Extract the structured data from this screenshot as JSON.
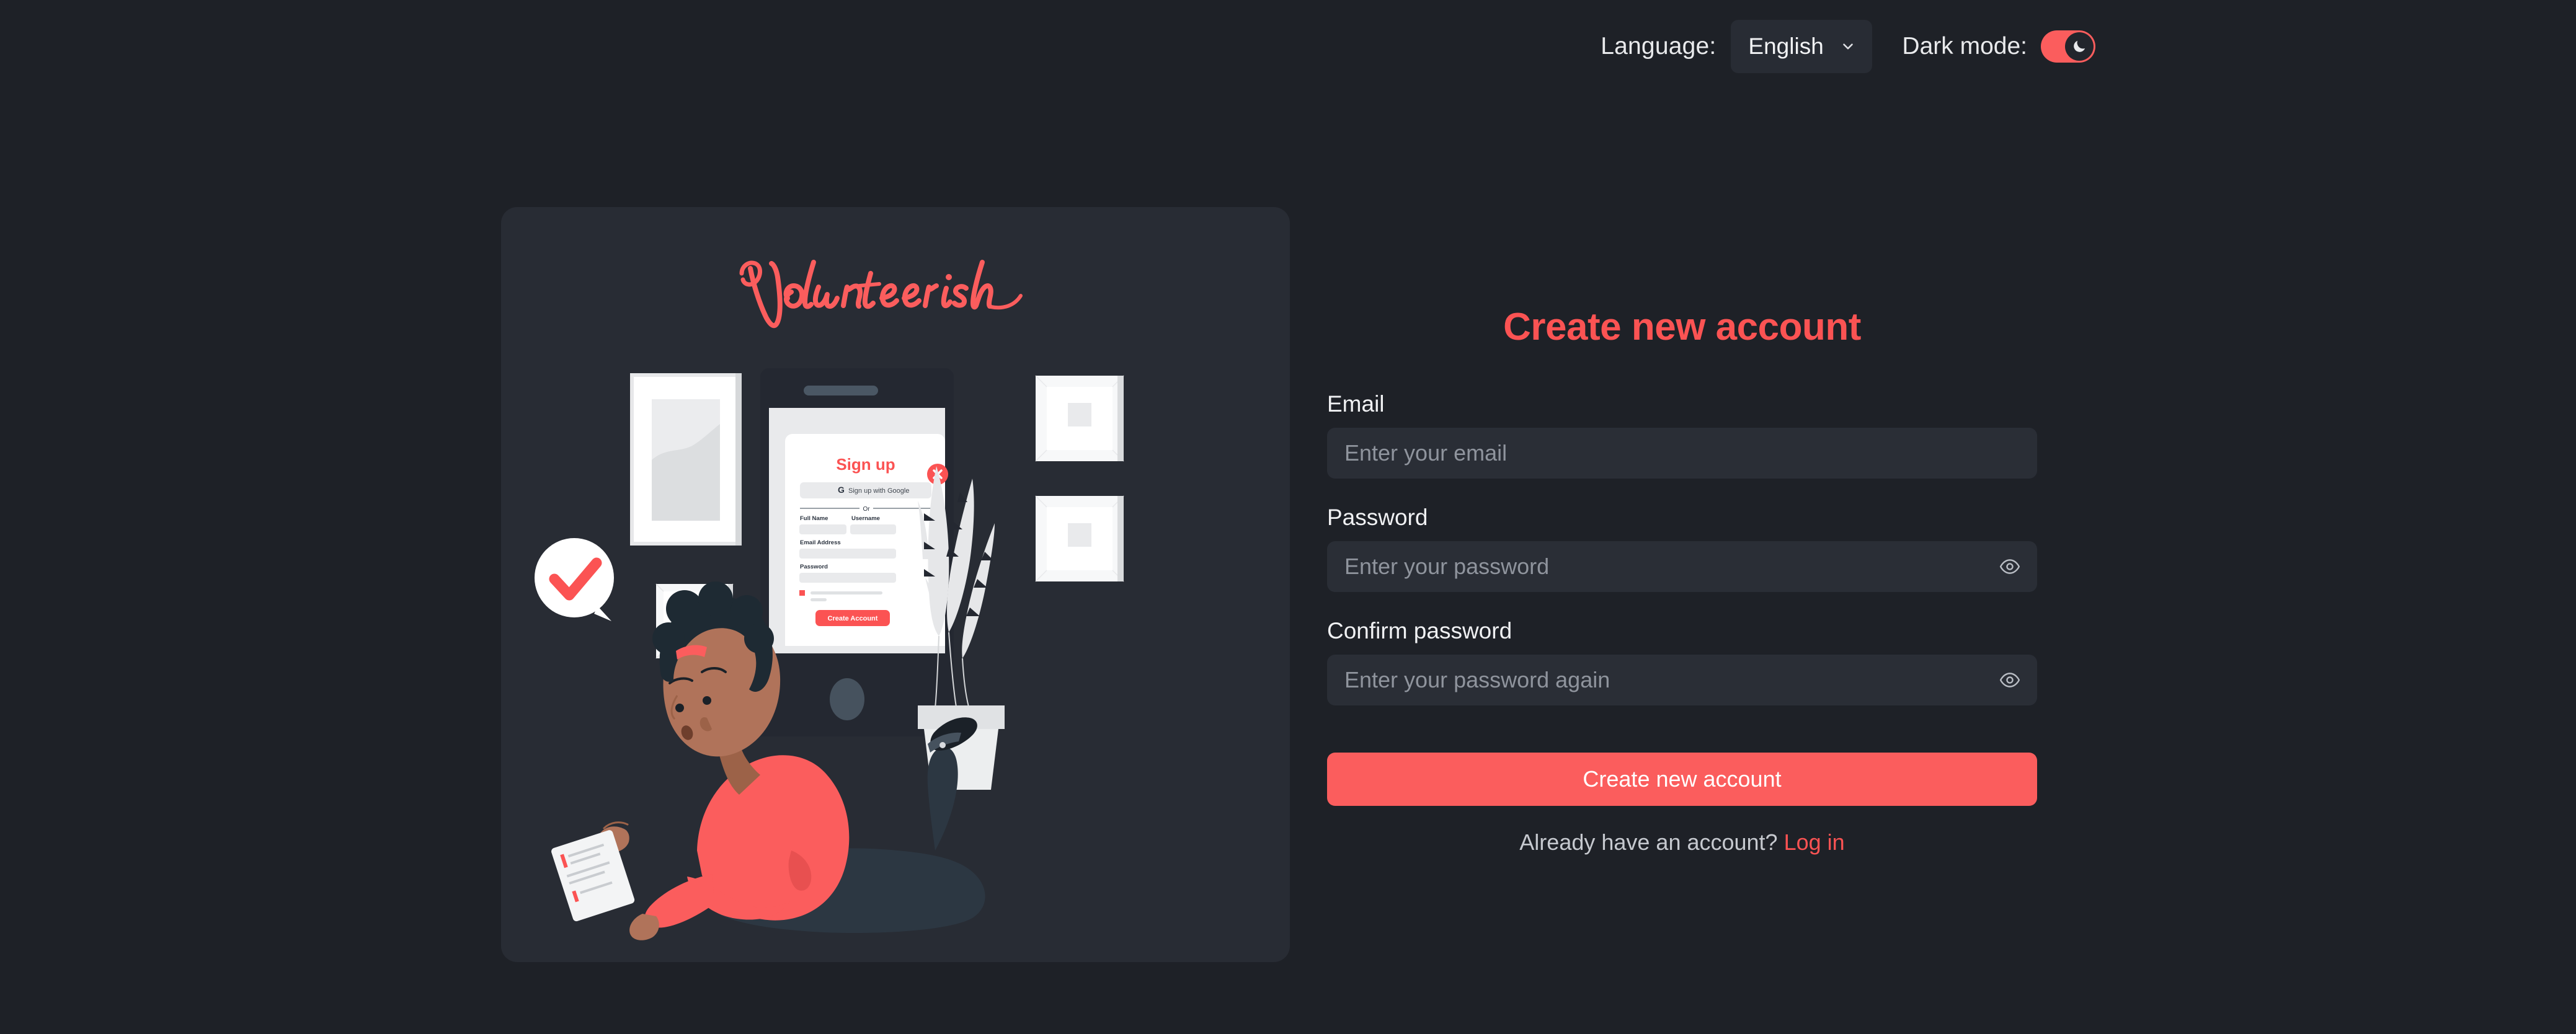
{
  "topbar": {
    "language_label": "Language:",
    "language_value": "English",
    "language_options": [
      "English"
    ],
    "chevron_icon": "chevron-down-icon",
    "dark_mode_label": "Dark mode:",
    "dark_mode_on": true,
    "dark_mode_icon": "moon-icon"
  },
  "brand": {
    "logo_text": "Volunteerish",
    "logo_color": "#fb5d5d"
  },
  "illustration": {
    "alt": "person lying down using a phone next to a desktop monitor showing a sign up form",
    "phone": {
      "dialog_title": "Sign up",
      "close_icon": "close-icon",
      "google_button": "Sign up with Google",
      "google_icon": "google-g-icon",
      "divider_text": "Or",
      "fields": [
        {
          "label": "Full Name"
        },
        {
          "label": "Username"
        },
        {
          "label": "Email Address"
        },
        {
          "label": "Password"
        }
      ],
      "submit_label": "Create Account"
    },
    "bubble_icon": "check-icon",
    "plant_icon": "potted-plant",
    "frames": [
      "tall-frame",
      "small-square-frame",
      "square-frame-top",
      "square-frame-bottom"
    ]
  },
  "form": {
    "title": "Create new account",
    "accent_color": "#fb5353",
    "fields": [
      {
        "label": "Email",
        "placeholder": "Enter your email",
        "value": "",
        "type": "email",
        "has_eye": false
      },
      {
        "label": "Password",
        "placeholder": "Enter your password",
        "value": "",
        "type": "password",
        "has_eye": true,
        "eye_icon": "eye-icon"
      },
      {
        "label": "Confirm password",
        "placeholder": "Enter your password again",
        "value": "",
        "type": "password",
        "has_eye": true,
        "eye_icon": "eye-icon"
      }
    ],
    "submit_label": "Create new account",
    "footer_text": "Already have an account?",
    "footer_link": "Log in"
  },
  "colors": {
    "page_bg": "#1e2127",
    "card_bg": "#282c34",
    "input_bg": "#2a2e36",
    "accent": "#fb5d5d",
    "text": "#f0f1f3",
    "placeholder": "#8f949d"
  }
}
